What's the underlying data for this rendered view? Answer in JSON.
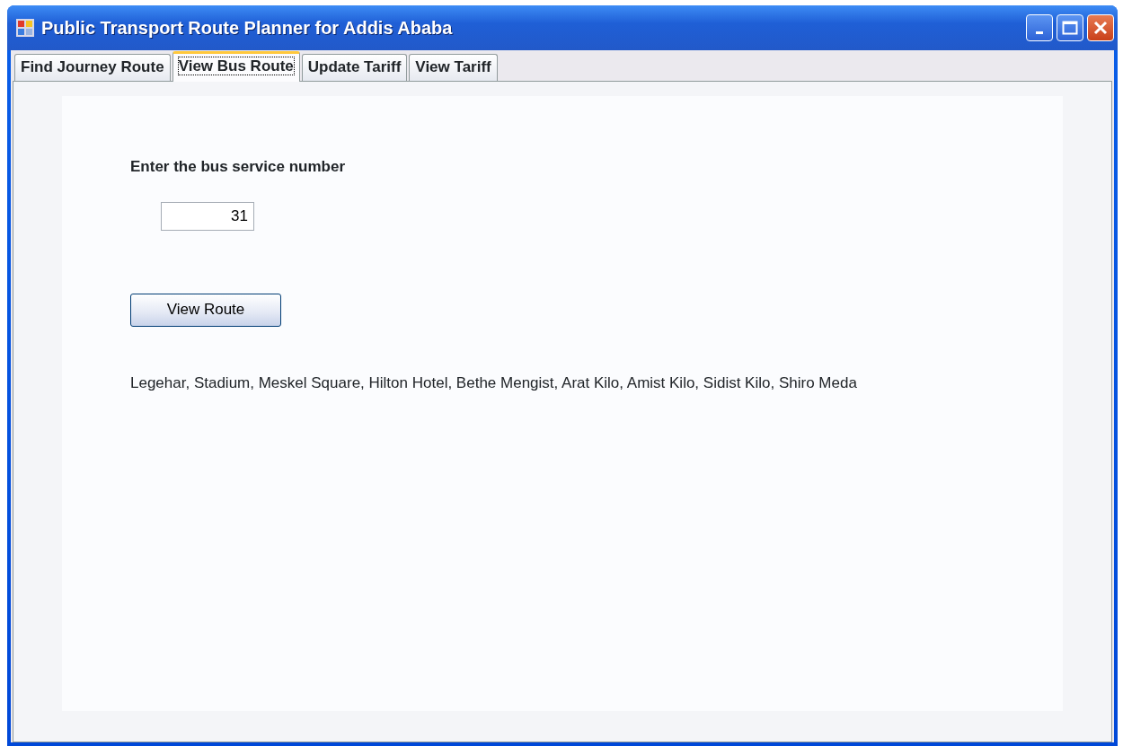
{
  "window": {
    "title": "Public Transport Route Planner for Addis Ababa"
  },
  "tabs": [
    {
      "label": "Find Journey Route",
      "selected": false
    },
    {
      "label": "View Bus Route",
      "selected": true
    },
    {
      "label": "Update Tariff",
      "selected": false
    },
    {
      "label": "View Tariff",
      "selected": false
    }
  ],
  "form": {
    "prompt": "Enter the bus service number",
    "service_number": "31",
    "button": "View Route",
    "route": "Legehar, Stadium, Meskel Square, Hilton Hotel, Bethe Mengist, Arat Kilo, Amist Kilo, Sidist Kilo, Shiro Meda"
  }
}
